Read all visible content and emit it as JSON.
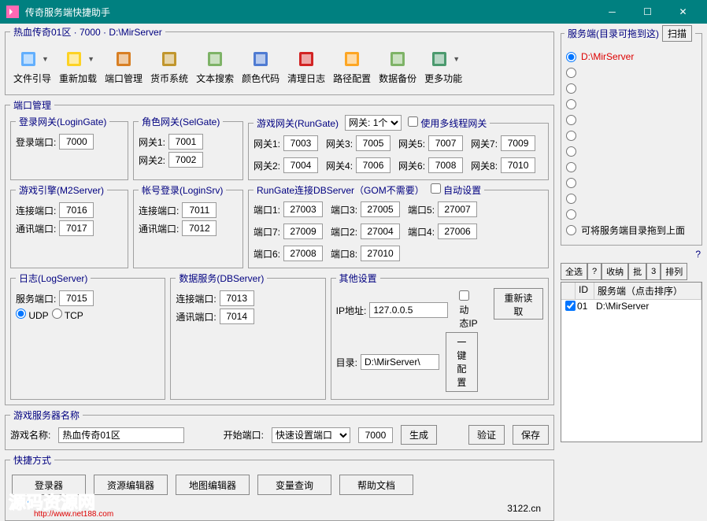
{
  "title": "传奇服务端快捷助手",
  "breadcrumb": "热血传奇01区 · 7000 · D:\\MirServer",
  "toolbar": [
    {
      "label": "文件引导",
      "dd": true,
      "color": "#4aa3ff"
    },
    {
      "label": "重新加载",
      "dd": true,
      "color": "#ffcc00"
    },
    {
      "label": "端口管理",
      "dd": false,
      "color": "#d46b00"
    },
    {
      "label": "货币系统",
      "dd": false,
      "color": "#b8860b"
    },
    {
      "label": "文本搜索",
      "dd": false,
      "color": "#6aa84f"
    },
    {
      "label": "颜色代码",
      "dd": false,
      "color": "#3366cc"
    },
    {
      "label": "清理日志",
      "dd": false,
      "color": "#cc0000"
    },
    {
      "label": "路径配置",
      "dd": false,
      "color": "#ff9900"
    },
    {
      "label": "数据备份",
      "dd": false,
      "color": "#6aa84f"
    },
    {
      "label": "更多功能",
      "dd": true,
      "color": "#2e8b57"
    }
  ],
  "portmgr_legend": "端口管理",
  "logingate": {
    "legend": "登录网关(LoginGate)",
    "lbl": "登录端口:",
    "val": "7000"
  },
  "selgate": {
    "legend": "角色网关(SelGate)",
    "g1l": "网关1:",
    "g1v": "7001",
    "g2l": "网关2:",
    "g2v": "7002"
  },
  "rungate": {
    "legend": "游戏网关(RunGate)",
    "count_lbl": "网关: 1个",
    "multi_lbl": "使用多线程网关",
    "items": [
      {
        "l": "网关1:",
        "v": "7003"
      },
      {
        "l": "网关2:",
        "v": "7004"
      },
      {
        "l": "网关3:",
        "v": "7005"
      },
      {
        "l": "网关4:",
        "v": "7006"
      },
      {
        "l": "网关5:",
        "v": "7007"
      },
      {
        "l": "网关6:",
        "v": "7008"
      },
      {
        "l": "网关7:",
        "v": "7009"
      },
      {
        "l": "网关8:",
        "v": "7010"
      }
    ]
  },
  "m2": {
    "legend": "游戏引擎(M2Server)",
    "l1": "连接端口:",
    "v1": "7016",
    "l2": "通讯端口:",
    "v2": "7017"
  },
  "loginsrv": {
    "legend": "帐号登录(LoginSrv)",
    "l1": "连接端口:",
    "v1": "7011",
    "l2": "通讯端口:",
    "v2": "7012"
  },
  "rundb": {
    "legend": "RunGate连接DBServer（GOM不需要）",
    "auto_lbl": "自动设置",
    "items": [
      {
        "l": "端口1:",
        "v": "27003"
      },
      {
        "l": "端口2:",
        "v": "27004"
      },
      {
        "l": "端口3:",
        "v": "27005"
      },
      {
        "l": "端口4:",
        "v": "27006"
      },
      {
        "l": "端口5:",
        "v": "27007"
      },
      {
        "l": "端口6:",
        "v": "27008"
      },
      {
        "l": "端口7:",
        "v": "27009"
      },
      {
        "l": "端口8:",
        "v": "27010"
      }
    ]
  },
  "logsrv": {
    "legend": "日志(LogServer)",
    "l1": "服务端口:",
    "v1": "7015",
    "udp": "UDP",
    "tcp": "TCP"
  },
  "dbsrv": {
    "legend": "数据服务(DBServer)",
    "l1": "连接端口:",
    "v1": "7013",
    "l2": "通讯端口:",
    "v2": "7014"
  },
  "other": {
    "legend": "其他设置",
    "ipl": "IP地址:",
    "ipv": "127.0.0.5",
    "dynip": "动态IP",
    "dirl": "目录:",
    "dirv": "D:\\MirServer\\",
    "onekey": "一键配置",
    "reread": "重新读取"
  },
  "gamename": {
    "legend": "游戏服务器名称",
    "lbl": "游戏名称:",
    "val": "热血传奇01区",
    "startl": "开始端口:",
    "sel": "快速设置端口",
    "portv": "7000",
    "gen": "生成",
    "verify": "验证",
    "save": "保存"
  },
  "quick": {
    "legend": "快捷方式",
    "b1": "登录器",
    "b2": "资源编辑器",
    "b3": "地图编辑器",
    "b4": "变量查询",
    "b5": "帮助文档"
  },
  "footer": "3122.cn",
  "right": {
    "legend": "服务端(目录可拖到这)",
    "scan": "扫描",
    "selected": "D:\\MirServer",
    "drag_hint": "可将服务端目录拖到上面",
    "tb": {
      "all": "全选",
      "q": "?",
      "fold": "收纳",
      "batch": "批",
      "n3": "3",
      "sort": "排列"
    },
    "head": {
      "id": "ID",
      "path": "服务端（点击排序）"
    },
    "row": {
      "id": "01",
      "path": "D:\\MirServer"
    }
  },
  "watermark": "源码资源网",
  "watermark_url": "http://www.net188.com"
}
